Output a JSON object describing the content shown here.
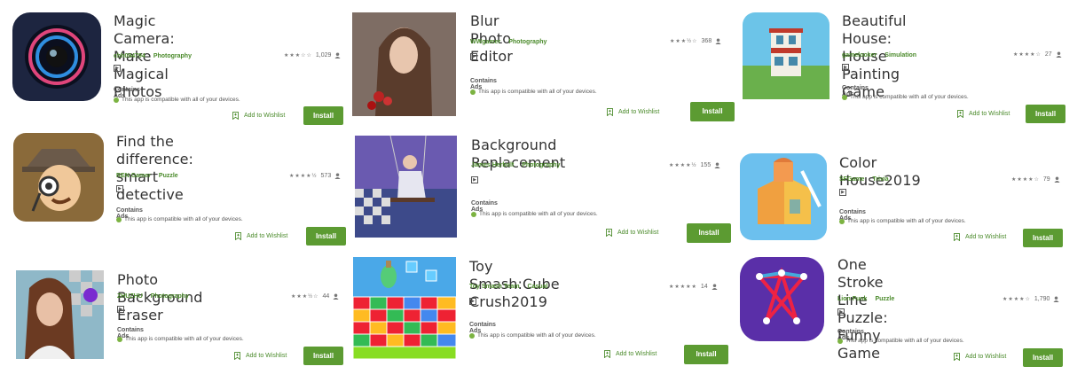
{
  "common": {
    "contains_ads": "Contains Ads",
    "compat_text": "This app is compatible with all of your devices.",
    "wishlist_label": "Add to Wishlist",
    "install_label": "Install",
    "rated_badge": "▶",
    "accent": "#5c9b32"
  },
  "apps": [
    {
      "title_lines": [
        "Magic Camera: Make Magical",
        "Photos"
      ],
      "developer": "chh094794",
      "category": "Photography",
      "stars": "★★★☆☆",
      "rating_count": "1,029"
    },
    {
      "title_lines": [
        "Blur Photo Editor"
      ],
      "developer": "WWgamer",
      "category": "Photography",
      "stars": "★★★½☆",
      "rating_count": "368"
    },
    {
      "title_lines": [
        "Beautiful House: House Painting",
        "Game"
      ],
      "developer": "gamelooker",
      "category": "Simulation",
      "stars": "★★★★☆",
      "rating_count": "27"
    },
    {
      "title_lines": [
        "Find the difference: smart",
        "detective"
      ],
      "developer": "REN Gamer",
      "category": "Puzzle",
      "stars": "★★★★½",
      "rating_count": "573"
    },
    {
      "title_lines": [
        "Background Replacement"
      ],
      "developer": "James Herbolt",
      "category": "Photography",
      "stars": "★★★★½",
      "rating_count": "155"
    },
    {
      "title_lines": [
        "Color House2019"
      ],
      "developer": "SFGame",
      "category": "Trivia",
      "stars": "★★★★☆",
      "rating_count": "79"
    },
    {
      "title_lines": [
        "Photo Background Eraser"
      ],
      "developer": "ZHUZHU",
      "category": "Photography",
      "stars": "★★★½☆",
      "rating_count": "44"
    },
    {
      "title_lines": [
        "Toy Smash:Cube Crush2019"
      ],
      "developer": "Toy Smash Team",
      "category": "Casual",
      "stars": "★★★★★",
      "rating_count": "14"
    },
    {
      "title_lines": [
        "One Stroke Line Puzzle: Funny",
        "Game"
      ],
      "developer": "Lion Funk",
      "category": "Puzzle",
      "stars": "★★★★☆",
      "rating_count": "1,790"
    }
  ]
}
